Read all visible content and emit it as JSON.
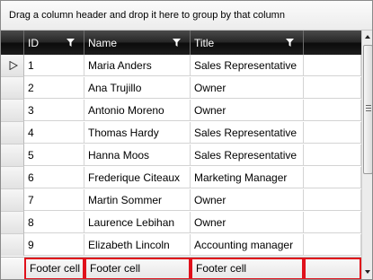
{
  "group_panel": {
    "text": "Drag a column header and drop it here to group by that column"
  },
  "columns": [
    {
      "key": "id",
      "label": "ID",
      "icon": "filter-icon"
    },
    {
      "key": "name",
      "label": "Name",
      "icon": "filter-icon"
    },
    {
      "key": "title",
      "label": "Title",
      "icon": "filter-icon"
    }
  ],
  "rows": [
    {
      "id": "1",
      "name": "Maria Anders",
      "title": "Sales Representative",
      "current": true
    },
    {
      "id": "2",
      "name": "Ana Trujillo",
      "title": "Owner"
    },
    {
      "id": "3",
      "name": "Antonio Moreno",
      "title": "Owner"
    },
    {
      "id": "4",
      "name": "Thomas Hardy",
      "title": "Sales Representative"
    },
    {
      "id": "5",
      "name": "Hanna Moos",
      "title": "Sales Representative"
    },
    {
      "id": "6",
      "name": "Frederique Citeaux",
      "title": "Marketing Manager"
    },
    {
      "id": "7",
      "name": "Martin Sommer",
      "title": "Owner"
    },
    {
      "id": "8",
      "name": "Laurence Lebihan",
      "title": "Owner"
    },
    {
      "id": "9",
      "name": "Elizabeth Lincoln",
      "title": "Accounting manager"
    }
  ],
  "footer": {
    "id": "Footer cell",
    "name": "Footer cell",
    "title": "Footer cell",
    "extra": ""
  },
  "colors": {
    "header_bg": "#1c1c1c",
    "footer_highlight": "#e0111b",
    "grid_line": "#d3d3d3"
  },
  "scrollbar": {
    "icons": [
      "scroll-up-icon",
      "scroll-grip-icon",
      "scroll-down-icon"
    ]
  }
}
